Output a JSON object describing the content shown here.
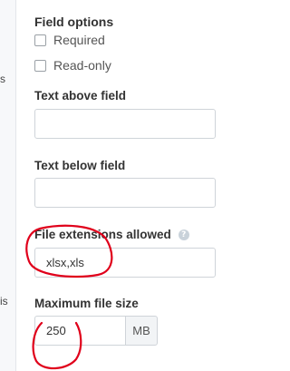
{
  "left_fragments": [
    "s",
    "is"
  ],
  "field_options": {
    "title": "Field options",
    "required_label": "Required",
    "readonly_label": "Read-only"
  },
  "text_above": {
    "label": "Text above field",
    "value": ""
  },
  "text_below": {
    "label": "Text below field",
    "value": ""
  },
  "file_extensions": {
    "label": "File extensions allowed",
    "value": "xlsx,xls",
    "help_icon": "question-circle-icon"
  },
  "max_file_size": {
    "label": "Maximum file size",
    "value": "250",
    "unit": "MB"
  },
  "annotation_color": "#e0001b"
}
